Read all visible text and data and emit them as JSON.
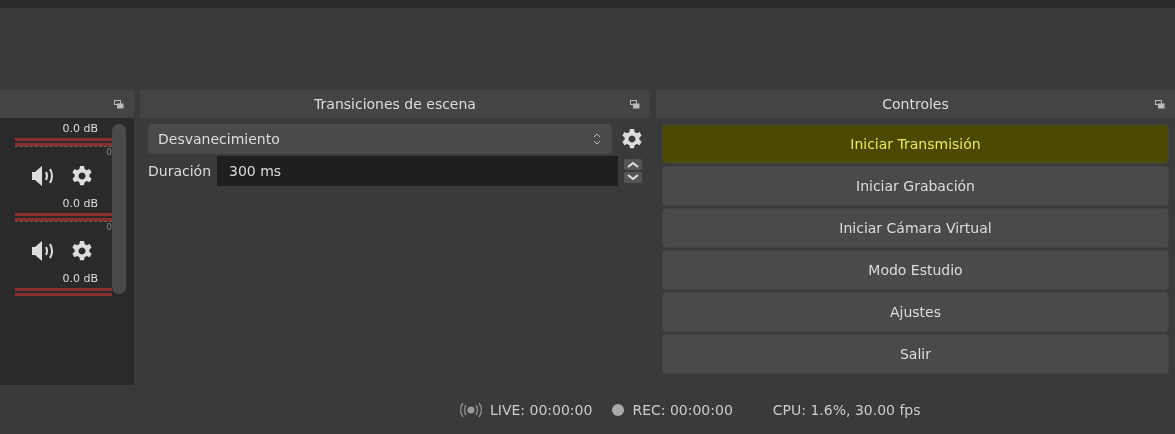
{
  "mixer": {
    "channels": [
      {
        "reading": "0.0 dB",
        "tick": "0"
      },
      {
        "reading": "0.0 dB",
        "tick": "0"
      },
      {
        "reading": "0.0 dB"
      }
    ]
  },
  "transitions": {
    "title": "Transiciones de escena",
    "transition": "Desvanecimiento",
    "duration_label": "Duración",
    "duration": "300 ms"
  },
  "controls": {
    "title": "Controles",
    "buttons": [
      {
        "label": "Iniciar Transmisión",
        "highlighted": true
      },
      {
        "label": "Iniciar Grabación",
        "highlighted": false
      },
      {
        "label": "Iniciar Cámara Virtual",
        "highlighted": false
      },
      {
        "label": "Modo Estudio",
        "highlighted": false
      },
      {
        "label": "Ajustes",
        "highlighted": false
      },
      {
        "label": "Salir",
        "highlighted": false
      }
    ]
  },
  "status_bar": {
    "live": "LIVE: 00:00:00",
    "rec": "REC: 00:00:00",
    "cpu": "CPU: 1.6%, 30.00 fps"
  }
}
